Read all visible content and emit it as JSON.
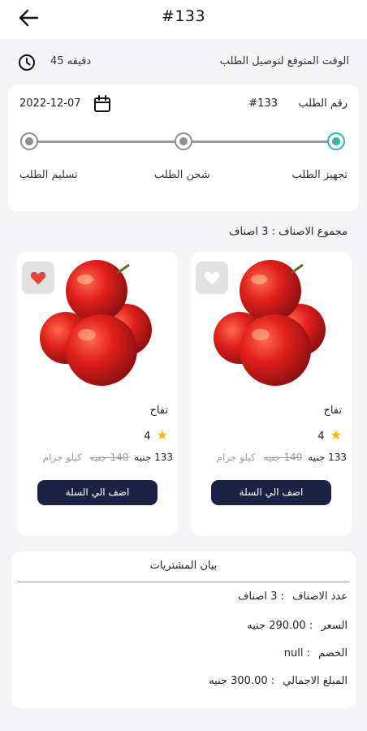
{
  "appbar": {
    "title": "#133"
  },
  "eta": {
    "label": "الوقت المتوقع لتوصيل الطلب",
    "value": "45 دقيقه"
  },
  "order": {
    "date": "2022-12-07",
    "number_label": "رقم الطلب",
    "number_value": "#133",
    "steps": [
      {
        "label": "تجهيز الطلب",
        "active": true
      },
      {
        "label": "شحن الطلب",
        "active": false
      },
      {
        "label": "تسليم الطلب",
        "active": false
      }
    ]
  },
  "summary": {
    "items_count_text": "مجموع الاصناف : 3 اصناف"
  },
  "products": [
    {
      "name": "تفاح",
      "rating": "4",
      "price": "133 جنيه",
      "old_price": "140 جنيه",
      "unit": "كيلو جرام",
      "favorited": false,
      "add_label": "اضف الي السلة"
    },
    {
      "name": "تفاح",
      "rating": "4",
      "price": "133 جنيه",
      "old_price": "140 جنيه",
      "unit": "كيلو جرام",
      "favorited": true,
      "add_label": "اضف الي السلة"
    }
  ],
  "bill": {
    "title": "بيان المشتريات",
    "rows": [
      {
        "label": "عدد الاصناف",
        "value": ": 3 اصناف"
      },
      {
        "label": "السعر",
        "value": ": 290.00 جنيه"
      },
      {
        "label": "الخصم",
        "value": ": null"
      },
      {
        "label": "المبلغ الاجمالي",
        "value": ": 300.00 جنيه"
      }
    ]
  },
  "colors": {
    "primary_button": "#1a2345",
    "active_step": "#2fb5a3",
    "favorite": "#e8423f",
    "star": "#f5b400"
  }
}
